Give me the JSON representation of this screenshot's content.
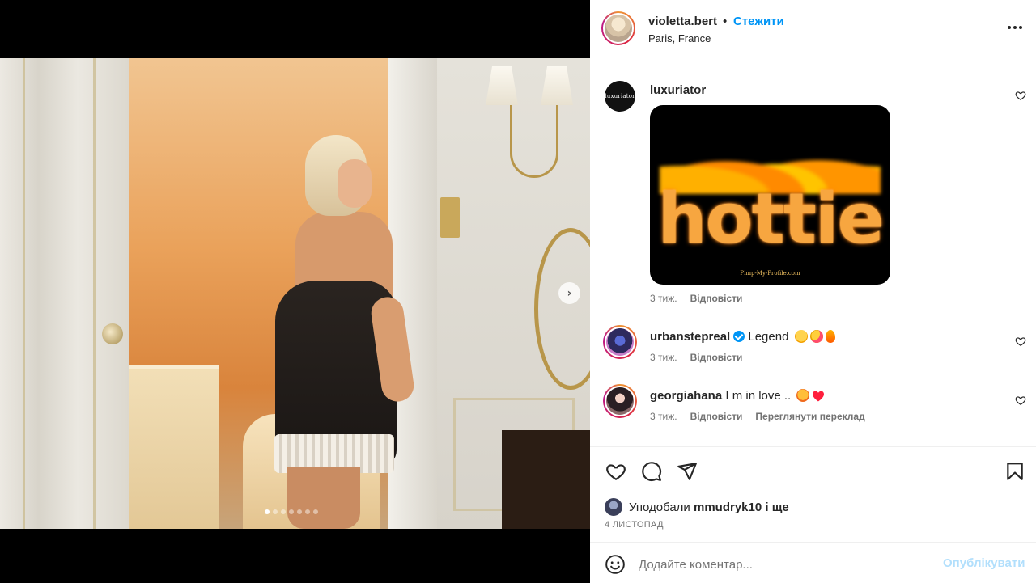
{
  "post": {
    "carousel": {
      "slide_count": 7,
      "active_slide": 1
    },
    "next_icon": "chevron-right-icon"
  },
  "header": {
    "username": "violetta.bert",
    "separator": "•",
    "follow_label": "Стежити",
    "location": "Paris, France",
    "more_icon": "more-horizontal-icon"
  },
  "comments": [
    {
      "username": "luxuriator",
      "avatar_text": "luxuriator",
      "text": "",
      "gif": {
        "word": "hottie",
        "credit": "Pimp-My-Profile.com"
      },
      "time": "3 тиж.",
      "reply_label": "Відповісти"
    },
    {
      "username": "urbanstepreal",
      "verified": true,
      "text": "Legend",
      "emojis": [
        "flushed-face",
        "heart-eyes-face",
        "fire"
      ],
      "time": "3 тиж.",
      "reply_label": "Відповісти"
    },
    {
      "username": "georgiahana",
      "text": "I m in love ..",
      "emojis": [
        "hot-face",
        "red-heart"
      ],
      "time": "3 тиж.",
      "reply_label": "Відповісти",
      "translate_label": "Переглянути переклад"
    }
  ],
  "likes": {
    "prefix": "Уподобали",
    "user": "mmudryk10",
    "suffix": "і ще"
  },
  "date": "4 ЛИСТОПАД",
  "composer": {
    "placeholder": "Додайте коментар...",
    "publish_label": "Опублікувати"
  },
  "colors": {
    "link": "#0095f6",
    "publish_disabled": "#b2dffc",
    "secondary_text": "#737373"
  }
}
